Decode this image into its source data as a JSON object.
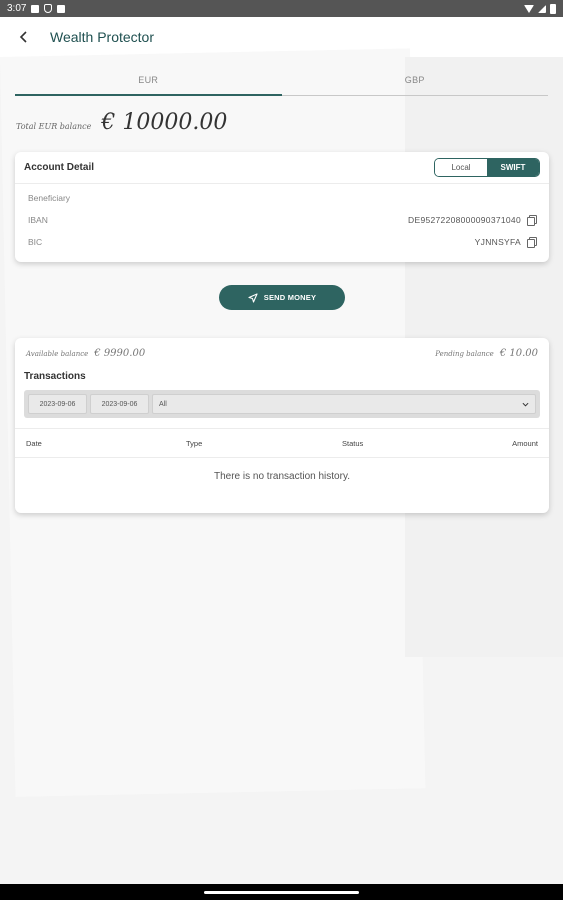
{
  "status_bar": {
    "time": "3:07"
  },
  "app_bar": {
    "title": "Wealth Protector"
  },
  "tabs": [
    {
      "label": "EUR",
      "active": true
    },
    {
      "label": "GBP",
      "active": false
    }
  ],
  "total": {
    "label": "Total EUR balance",
    "amount": "€ 10000.00"
  },
  "account": {
    "title": "Account Detail",
    "toggle": {
      "local": "Local",
      "swift": "SWIFT",
      "selected": "SWIFT"
    },
    "beneficiary_label": "Beneficiary",
    "iban_label": "IBAN",
    "iban_value": "DE95272208000090371040",
    "bic_label": "BIC",
    "bic_value": "YJNNSYFA"
  },
  "send_button": {
    "label": "SEND MONEY"
  },
  "transactions": {
    "available_label": "Available balance",
    "available_value": "€ 9990.00",
    "pending_label": "Pending balance",
    "pending_value": "€ 10.00",
    "title": "Transactions",
    "date_from": "2023-09-06",
    "date_to": "2023-09-06",
    "status_filter": "All",
    "columns": [
      "Date",
      "Type",
      "Status",
      "Amount"
    ],
    "empty_message": "There is no transaction history."
  },
  "colors": {
    "accent": "#2e6461",
    "title": "#1f5050"
  }
}
